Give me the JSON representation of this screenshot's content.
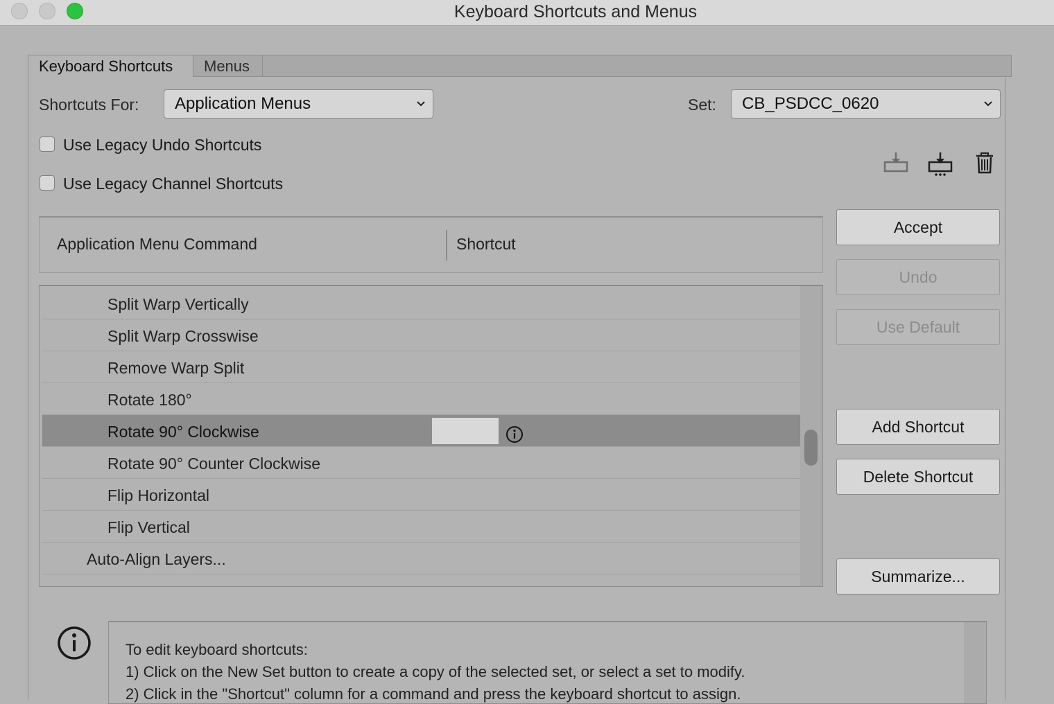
{
  "window": {
    "title": "Keyboard Shortcuts and Menus"
  },
  "tabs": [
    {
      "label": "Keyboard Shortcuts",
      "active": true
    },
    {
      "label": "Menus",
      "active": false
    }
  ],
  "shortcuts_for": {
    "label": "Shortcuts For:",
    "value": "Application Menus"
  },
  "set": {
    "label": "Set:",
    "value": "CB_PSDCC_0620"
  },
  "options": {
    "legacy_undo": {
      "label": "Use Legacy Undo Shortcuts",
      "checked": false
    },
    "legacy_channel": {
      "label": "Use Legacy Channel Shortcuts",
      "checked": false
    }
  },
  "toolbar_icons": [
    "save-set-icon",
    "new-set-icon",
    "delete-set-icon"
  ],
  "table": {
    "col_command": "Application Menu Command",
    "col_shortcut": "Shortcut",
    "rows": [
      {
        "command": "Split Warp Vertically",
        "indent": "sub"
      },
      {
        "command": "Split Warp Crosswise",
        "indent": "sub"
      },
      {
        "command": "Remove Warp Split",
        "indent": "sub"
      },
      {
        "command": "Rotate 180°",
        "indent": "sub"
      },
      {
        "command": "Rotate 90° Clockwise",
        "indent": "sub",
        "selected": true,
        "shortcut": ""
      },
      {
        "command": "Rotate 90° Counter Clockwise",
        "indent": "sub"
      },
      {
        "command": "Flip Horizontal",
        "indent": "sub"
      },
      {
        "command": "Flip Vertical",
        "indent": "sub"
      },
      {
        "command": "Auto-Align Layers...",
        "indent": "top"
      }
    ]
  },
  "buttons": {
    "accept": "Accept",
    "undo": "Undo",
    "use_default": "Use Default",
    "add_shortcut": "Add Shortcut",
    "delete_shortcut": "Delete Shortcut",
    "summarize": "Summarize..."
  },
  "help": {
    "line1": "To edit keyboard shortcuts:",
    "line2": "1) Click on the New Set button to create a copy of the selected set, or select a set to modify.",
    "line3": "2) Click in the \"Shortcut\" column for a command and press the keyboard shortcut to assign."
  },
  "colors": {
    "selected_row": "#8c8c8c",
    "zoom_button": "#2cc340",
    "dialog_bg": "#b5b5b5"
  }
}
